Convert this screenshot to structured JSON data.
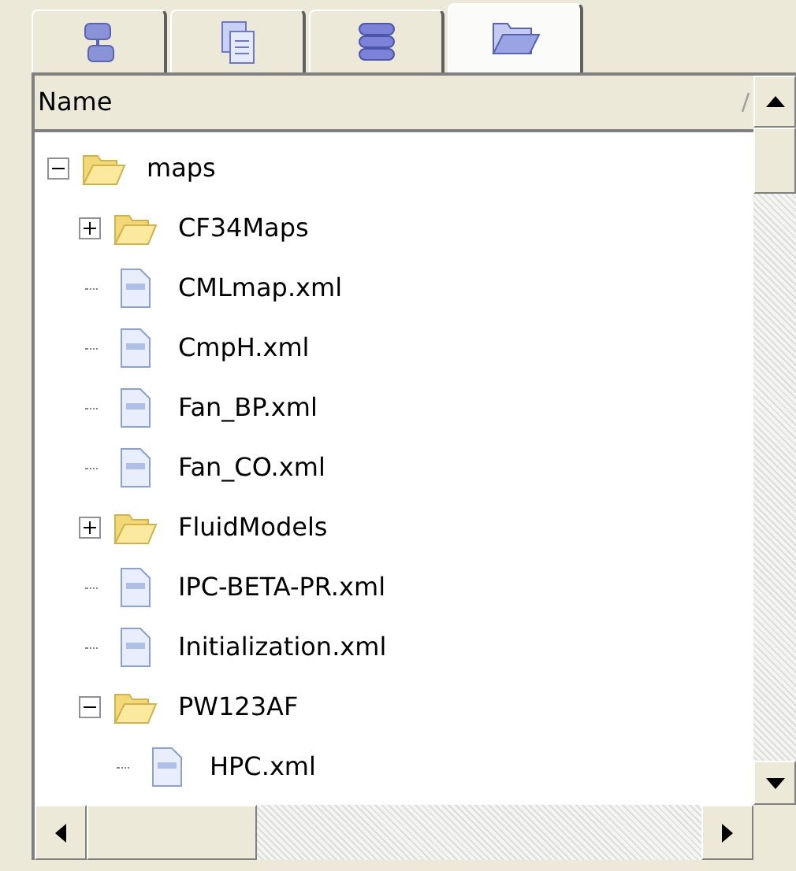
{
  "tabs": [
    {
      "selected": false
    },
    {
      "selected": false
    },
    {
      "selected": false
    },
    {
      "selected": true
    }
  ],
  "tree": {
    "column": "Name",
    "items": [
      {
        "kind": "folder",
        "label": "maps",
        "expanded": true,
        "children": [
          {
            "kind": "folder",
            "label": "CF34Maps",
            "expanded": false
          },
          {
            "kind": "file",
            "label": "CMLmap.xml"
          },
          {
            "kind": "file",
            "label": "CmpH.xml"
          },
          {
            "kind": "file",
            "label": "Fan_BP.xml"
          },
          {
            "kind": "file",
            "label": "Fan_CO.xml"
          },
          {
            "kind": "folder",
            "label": "FluidModels",
            "expanded": false
          },
          {
            "kind": "file",
            "label": "IPC-BETA-PR.xml"
          },
          {
            "kind": "file",
            "label": "Initialization.xml"
          },
          {
            "kind": "folder",
            "label": "PW123AF",
            "expanded": true,
            "children": [
              {
                "kind": "file",
                "label": "HPC.xml"
              }
            ]
          }
        ]
      }
    ]
  }
}
